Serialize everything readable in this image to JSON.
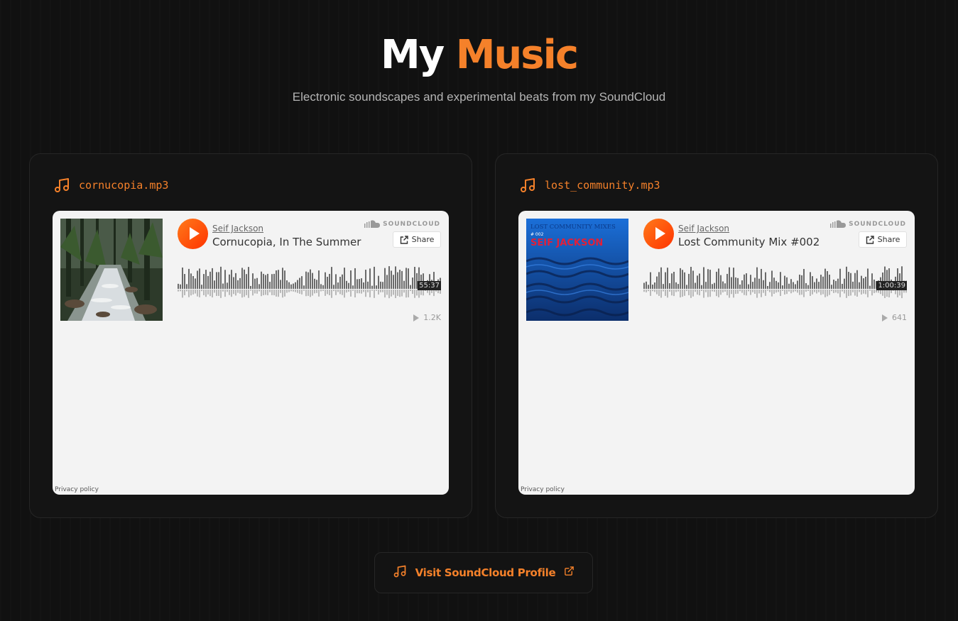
{
  "hero": {
    "title_part1": "My",
    "title_part2": "Music",
    "subtitle": "Electronic soundscapes and experimental beats from my SoundCloud"
  },
  "colors": {
    "accent": "#f5812a",
    "soundcloud_orange": "#ff5500",
    "background": "#111111"
  },
  "tracks": [
    {
      "filename": "cornucopia.mp3",
      "artist": "Seif Jackson",
      "title": "Cornucopia, In The Summer",
      "duration": "55:37",
      "plays": "1.2K",
      "artwork_icon": "forest-river-artwork"
    },
    {
      "filename": "lost_community.mp3",
      "artist": "Seif Jackson",
      "title": "Lost Community Mix #002",
      "duration": "1:00:39",
      "plays": "641",
      "artwork_icon": "ocean-artwork",
      "artwork_text": {
        "line1": "LOST COMMUNITY MIXES",
        "line2": "# 002",
        "line3": "SEIF JACKSON"
      }
    }
  ],
  "widget": {
    "brand": "SOUNDCLOUD",
    "share_label": "Share",
    "privacy_label": "Privacy policy"
  },
  "cta": {
    "label": "Visit SoundCloud Profile"
  }
}
